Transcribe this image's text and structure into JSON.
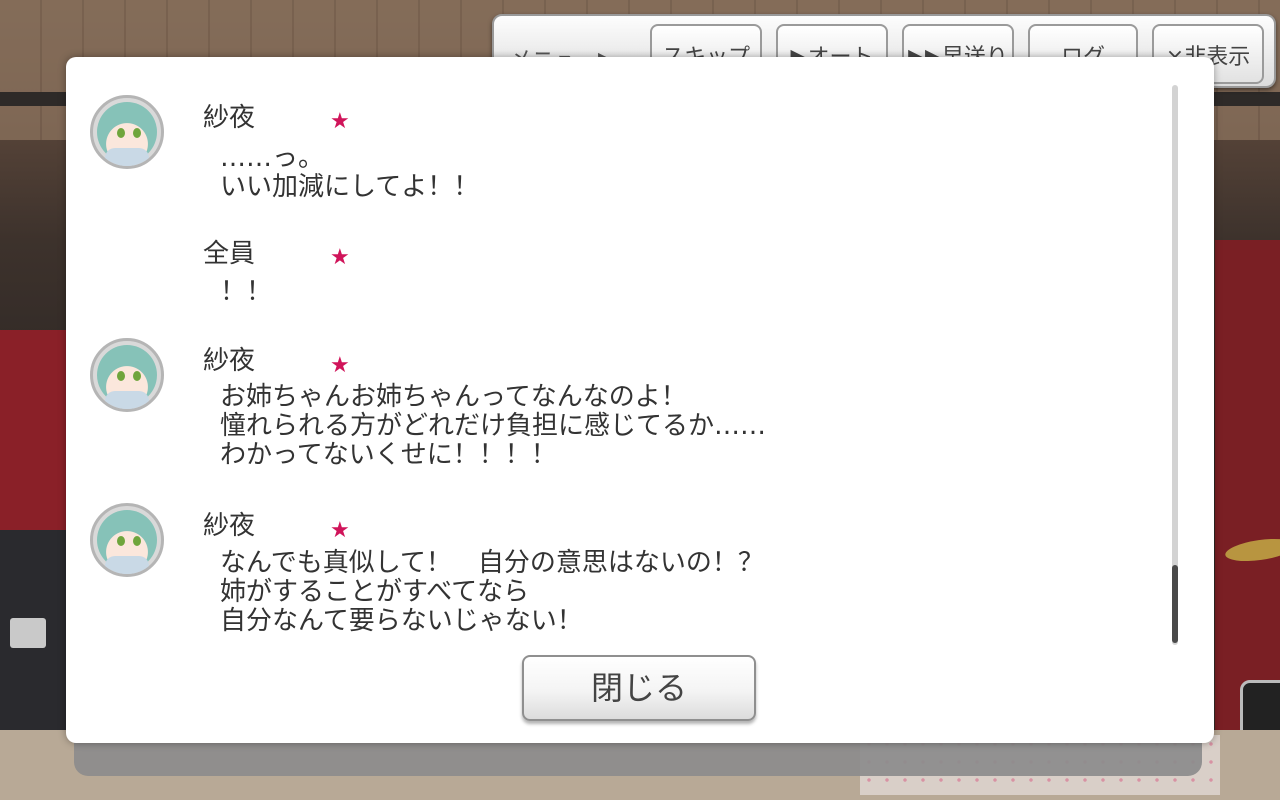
{
  "top_menu": {
    "menu_label": "メニュー▶",
    "buttons": [
      "スキップ",
      "▶オート",
      "▶▶早送り",
      "ログ",
      "×非表示"
    ]
  },
  "log": {
    "entries": [
      {
        "speaker": "紗夜",
        "lines": "……っ。\nいい加減にしてよ！！",
        "has_avatar": true
      },
      {
        "speaker": "全員",
        "lines": "！！",
        "has_avatar": false
      },
      {
        "speaker": "紗夜",
        "lines": "お姉ちゃんお姉ちゃんってなんなのよ！\n憧れられる方がどれだけ負担に感じてるか……\nわかってないくせに！！！！",
        "has_avatar": true
      },
      {
        "speaker": "紗夜",
        "lines": "なんでも真似して！　自分の意思はないの！？\n姉がすることがすべてなら\n自分なんて要らないじゃない！",
        "has_avatar": true
      }
    ],
    "star_glyph": "★",
    "close_label": "閉じる"
  },
  "colors": {
    "star": "#d0145a",
    "text": "#333333"
  }
}
